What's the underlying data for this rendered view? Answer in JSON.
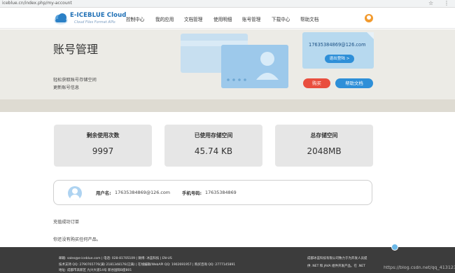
{
  "browser": {
    "url": "iceblue.cn/index.php/my-account"
  },
  "header": {
    "logo_name": "E-ICEBLUE Cloud",
    "logo_sub": "Cloud Files Format APIs",
    "nav": [
      "控制中心",
      "我的应用",
      "文档管理",
      "使用明细",
      "账号管理",
      "下载中心",
      "帮助文档"
    ]
  },
  "hero": {
    "title": "账号管理",
    "desc1": "轻松获取账号存储空间",
    "desc2": "更新账号信息",
    "card_email": "17635384869@126.com",
    "logout_label": "退出登陆 >",
    "buy_label": "购买",
    "help_label": "帮助文档"
  },
  "stats": [
    {
      "label": "剩余使用次数",
      "value": "9997"
    },
    {
      "label": "已使用存储空间",
      "value": "45.74 KB"
    },
    {
      "label": "总存储空间",
      "value": "2048MB"
    }
  ],
  "account": {
    "username_label": "用户名:",
    "username": "17635384869@126.com",
    "phone_label": "手机号码:",
    "phone": "17635384869"
  },
  "messages": {
    "order_success": "充值成功订单",
    "no_product": "你还没有购买任何产品。"
  },
  "footer": {
    "line1": "邮箱: sales@e-iceblue.com  |  电话: 028-81705109  |  微博: 冰蓝科技  |  EN-US",
    "line2": "技术支持 QQ: 2790765776(满) 2181348176(已满)  |  在线编辑/WebAPI QQ: 1902691957  |  购买咨询 QQ: 2777145891",
    "line3": "地址: 成都市高新区 九兴大道14号 新谷国际B座801",
    "right1": "成都冰蓝科技有限公司致力于为开发人员提",
    "right2": "供 .NET 和 JAVA 组件开发产品。在 .NET",
    "watermark": "https://blog.csdn.net/qq_41312395"
  },
  "colors": {
    "brand": "#1e6fb5",
    "buy": "#e94e3e",
    "primary": "#2e8fd8",
    "footer_bg": "#3c3c3c"
  }
}
